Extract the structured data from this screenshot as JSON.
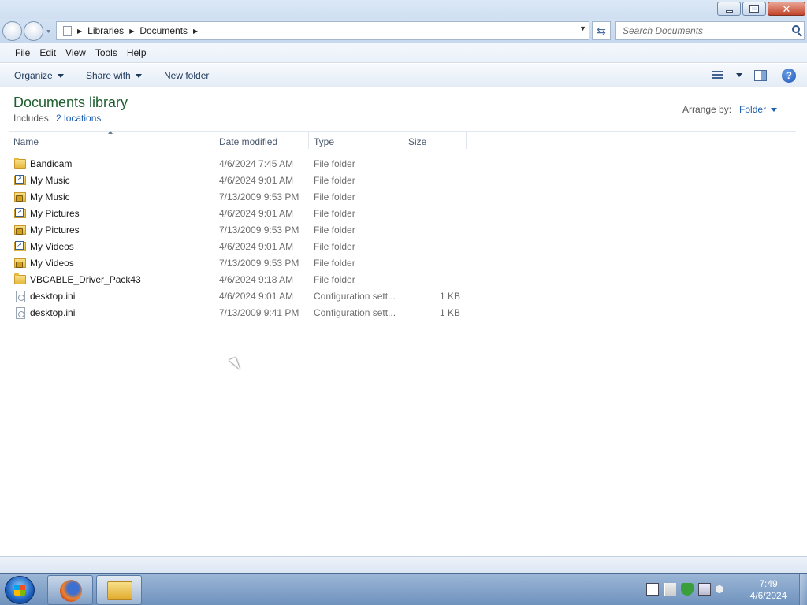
{
  "window": {
    "buttons": {
      "minimize": "minimize",
      "restore": "restore",
      "close": "close"
    }
  },
  "address": {
    "crumbs": [
      "Libraries",
      "Documents"
    ],
    "search_placeholder": "Search Documents"
  },
  "menu": [
    "File",
    "Edit",
    "View",
    "Tools",
    "Help"
  ],
  "commands": {
    "organize": "Organize",
    "share_with": "Share with",
    "new_folder": "New folder"
  },
  "library": {
    "title": "Documents library",
    "includes_label": "Includes:",
    "locations_link": "2 locations",
    "arrange_label": "Arrange by:",
    "arrange_value": "Folder"
  },
  "columns": {
    "name": "Name",
    "date": "Date modified",
    "type": "Type",
    "size": "Size"
  },
  "files": [
    {
      "name": "Bandicam",
      "date": "4/6/2024 7:45 AM",
      "type": "File folder",
      "size": "",
      "icon": "folder-icon"
    },
    {
      "name": "My Music",
      "date": "4/6/2024 9:01 AM",
      "type": "File folder",
      "size": "",
      "icon": "shortcut-folder-icon"
    },
    {
      "name": "My Music",
      "date": "7/13/2009 9:53 PM",
      "type": "File folder",
      "size": "",
      "icon": "locked-folder-icon"
    },
    {
      "name": "My Pictures",
      "date": "4/6/2024 9:01 AM",
      "type": "File folder",
      "size": "",
      "icon": "shortcut-folder-icon"
    },
    {
      "name": "My Pictures",
      "date": "7/13/2009 9:53 PM",
      "type": "File folder",
      "size": "",
      "icon": "locked-folder-icon"
    },
    {
      "name": "My Videos",
      "date": "4/6/2024 9:01 AM",
      "type": "File folder",
      "size": "",
      "icon": "shortcut-folder-icon"
    },
    {
      "name": "My Videos",
      "date": "7/13/2009 9:53 PM",
      "type": "File folder",
      "size": "",
      "icon": "locked-folder-icon"
    },
    {
      "name": "VBCABLE_Driver_Pack43",
      "date": "4/6/2024 9:18 AM",
      "type": "File folder",
      "size": "",
      "icon": "folder-icon"
    },
    {
      "name": "desktop.ini",
      "date": "4/6/2024 9:01 AM",
      "type": "Configuration sett...",
      "size": "1 KB",
      "icon": "config-file-icon"
    },
    {
      "name": "desktop.ini",
      "date": "7/13/2009 9:41 PM",
      "type": "Configuration sett...",
      "size": "1 KB",
      "icon": "config-file-icon"
    }
  ],
  "taskbar": {
    "time": "7:49",
    "date": "4/6/2024"
  },
  "colors": {
    "title_green": "#1e5e2f",
    "link_blue": "#1f5fb0",
    "taskbar_blue": "#6f92bd"
  }
}
